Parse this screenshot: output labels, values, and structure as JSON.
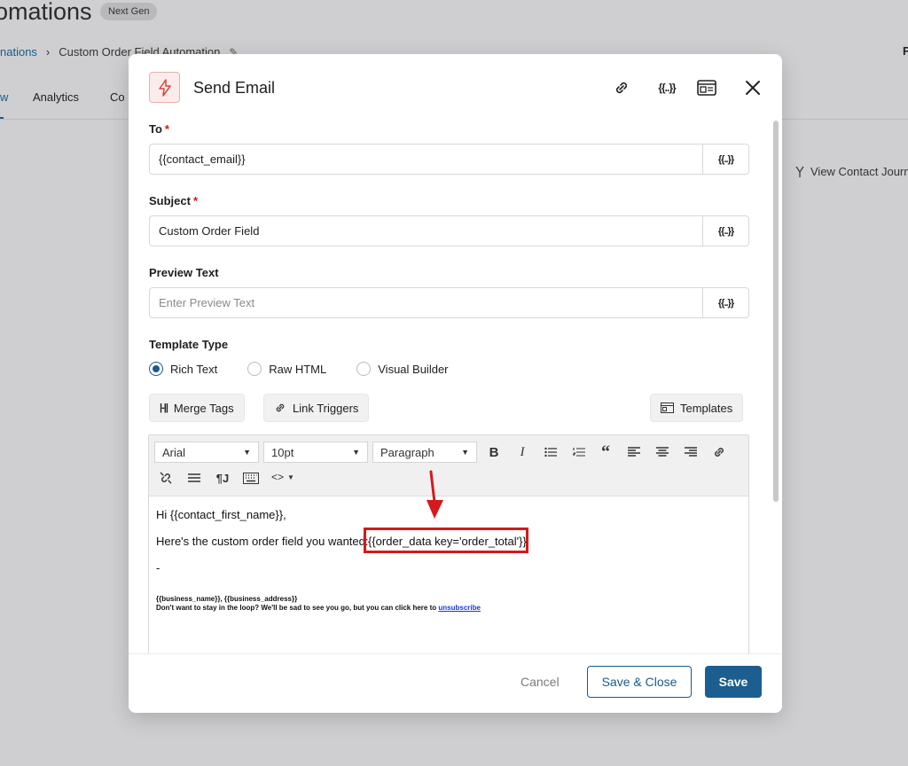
{
  "background": {
    "page_title": "omations",
    "badge": "Next Gen",
    "breadcrumb_link": "nations",
    "breadcrumb_current": "Custom Order Field Automation",
    "tabs": [
      "w",
      "Analytics",
      "Co"
    ],
    "journey_link": "View Contact Journ",
    "right_fragment": "F"
  },
  "modal": {
    "title": "Send Email",
    "to": {
      "label": "To",
      "required": "*",
      "value": "{{contact_email}}",
      "merge_icon": "{{..}}"
    },
    "subject": {
      "label": "Subject",
      "required": "*",
      "value": "Custom Order Field",
      "merge_icon": "{{..}}"
    },
    "preview_text": {
      "label": "Preview Text",
      "placeholder": "Enter Preview Text",
      "value": "",
      "merge_icon": "{{..}}"
    },
    "template_type": {
      "label": "Template Type",
      "options": [
        "Rich Text",
        "Raw HTML",
        "Visual Builder"
      ],
      "selected": "Rich Text"
    },
    "buttons": {
      "merge_tags": "Merge Tags",
      "link_triggers": "Link Triggers",
      "templates": "Templates"
    },
    "toolbar": {
      "font": "Arial",
      "size": "10pt",
      "block": "Paragraph",
      "icons": [
        "bold-icon",
        "italic-icon",
        "bullet-list-icon",
        "numbered-list-icon",
        "blockquote-icon",
        "align-left-icon",
        "align-center-icon",
        "align-right-icon",
        "link-icon",
        "unlink-icon",
        "horizontal-rule-icon",
        "paragraph-icon",
        "keyboard-icon",
        "code-icon"
      ]
    },
    "editor": {
      "greeting": "Hi {{contact_first_name}},",
      "line2": "Here's the custom order field you wanted: ",
      "merge_tag": "{{order_data key='order_total'}}",
      "dash": "-",
      "footer_line1": "{{business_name}}, {{business_address}}",
      "footer_line2": "Don't want to stay in the loop? We'll be sad to see you go, but you can click here to ",
      "unsubscribe": "unsubscribe"
    },
    "footer": {
      "cancel": "Cancel",
      "save_close": "Save & Close",
      "save": "Save"
    }
  },
  "colors": {
    "accent": "#1b5e8f",
    "highlight": "#d5191c",
    "required": "#cc1818",
    "icon_red": "#e0413a"
  }
}
